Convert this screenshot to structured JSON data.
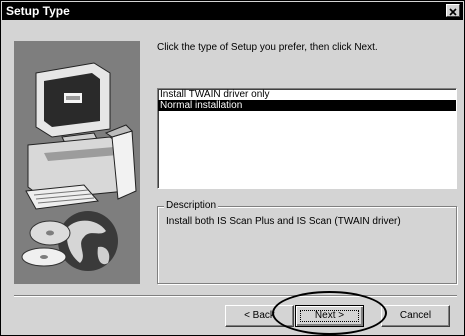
{
  "window": {
    "title": "Setup Type",
    "close_icon": "close-icon"
  },
  "instruction": "Click the type of Setup you prefer, then click Next.",
  "setup_options": [
    {
      "label": "Install TWAIN driver only",
      "selected": false
    },
    {
      "label": "Normal installation",
      "selected": true
    }
  ],
  "description": {
    "legend": "Description",
    "text": "Install both IS Scan Plus and IS Scan (TWAIN driver)"
  },
  "buttons": {
    "back_label": "< Back",
    "next_label": "Next >",
    "cancel_label": "Cancel"
  },
  "illustration": "computer-cd-globe-illustration",
  "colors": {
    "titlebar": "#000000",
    "dialog_face": "#d4d4d4",
    "art_panel": "#7e7e7e",
    "selection": "#000000"
  }
}
